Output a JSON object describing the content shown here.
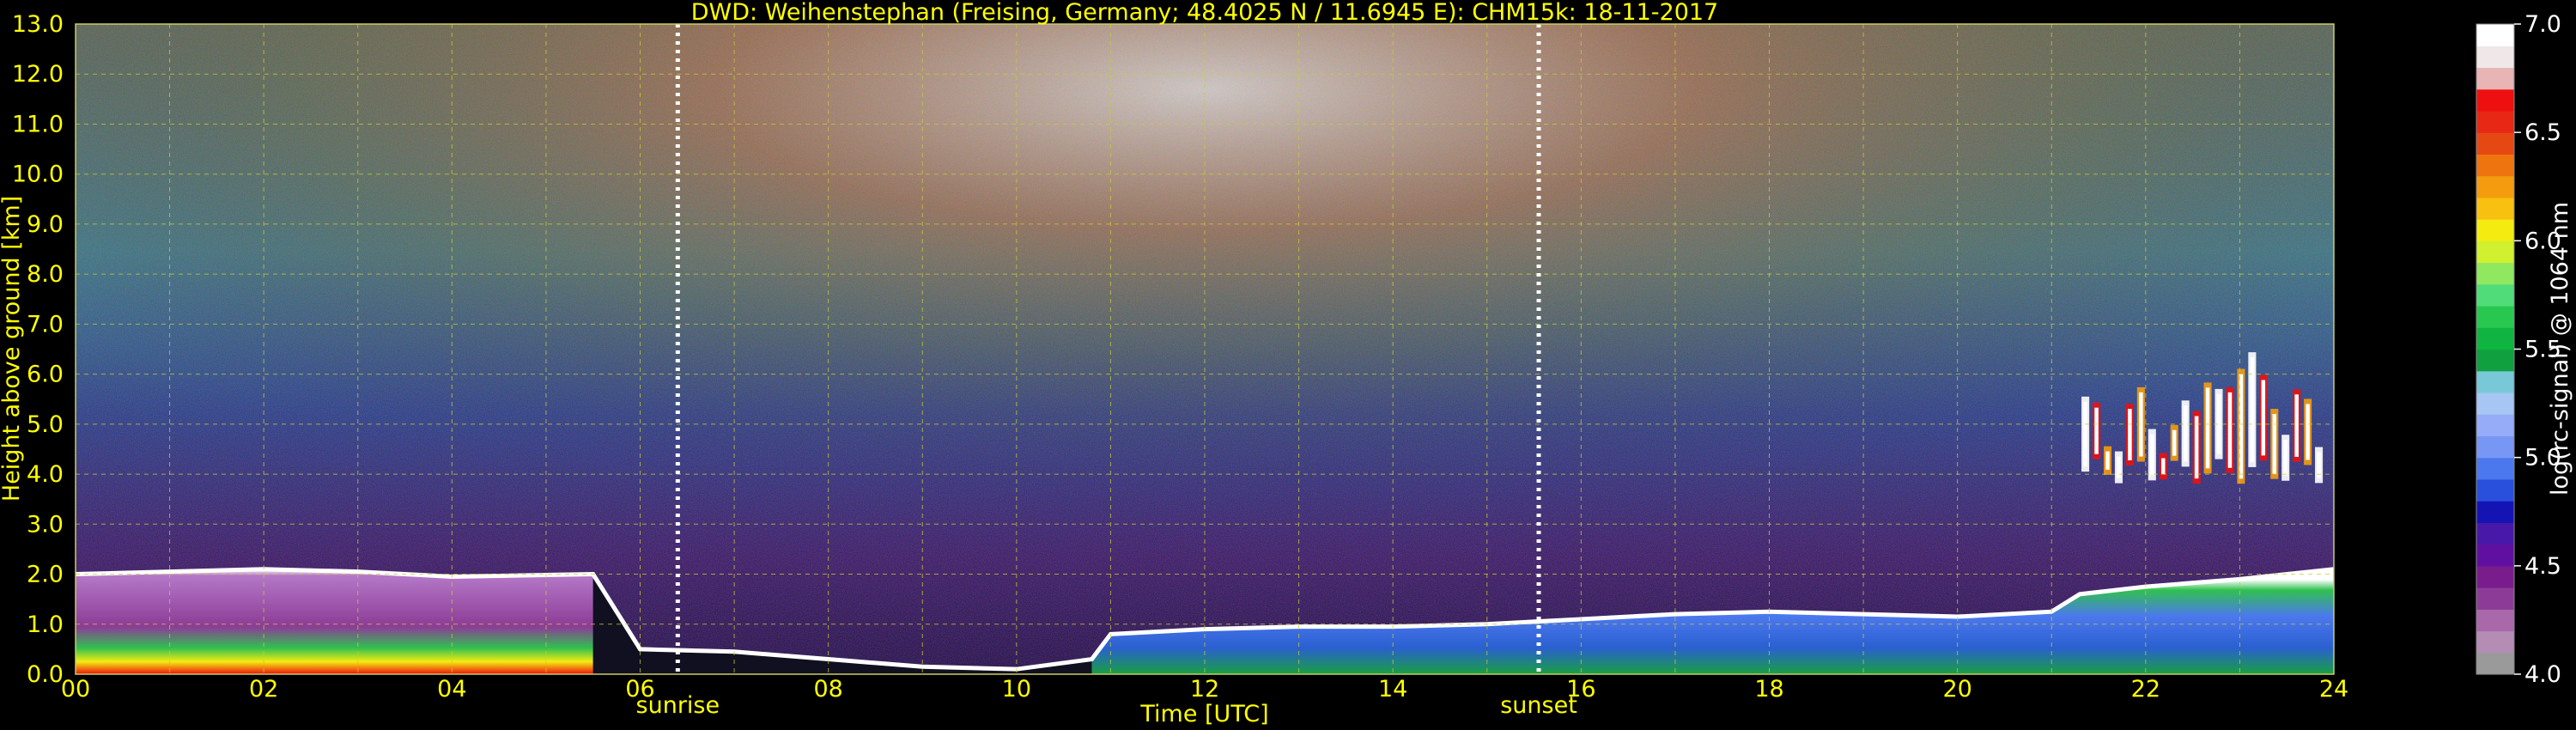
{
  "chart_data": {
    "type": "heatmap",
    "title": "DWD: Weihenstephan (Freising, Germany; 48.4025 N / 11.6945 E):    CHM15k: 18-11-2017",
    "xlabel": "Time [UTC]",
    "ylabel": "Height above ground [km]",
    "xlim": [
      0,
      24
    ],
    "ylim": [
      0,
      13
    ],
    "x_ticks": [
      "00",
      "02",
      "04",
      "06",
      "08",
      "10",
      "12",
      "14",
      "16",
      "18",
      "20",
      "22",
      "24"
    ],
    "y_ticks": [
      "0.0",
      "1.0",
      "2.0",
      "3.0",
      "4.0",
      "5.0",
      "6.0",
      "7.0",
      "8.0",
      "9.0",
      "10.0",
      "11.0",
      "12.0",
      "13.0"
    ],
    "grid": true,
    "annotations": [
      {
        "label": "sunrise",
        "x": 6.4
      },
      {
        "label": "sunset",
        "x": 15.55
      }
    ],
    "colorbar": {
      "label": "log(rc-signal) @ 1064 nm",
      "range": [
        4.0,
        7.0
      ],
      "tick_labels": [
        "4.0",
        "4.5",
        "5.0",
        "5.5",
        "6.0",
        "6.5",
        "7.0"
      ],
      "colors": [
        "#9a9a9a",
        "#b48cb4",
        "#a868aa",
        "#8c3c96",
        "#7a1d8c",
        "#6010a0",
        "#4818a8",
        "#1414b4",
        "#2850dc",
        "#4c78ee",
        "#7896f4",
        "#96acf8",
        "#a8c6f4",
        "#78c8d8",
        "#10a040",
        "#10b440",
        "#28c850",
        "#50dc78",
        "#90e860",
        "#d0f030",
        "#f4ec10",
        "#f8c010",
        "#f49c10",
        "#ee7410",
        "#e64814",
        "#e62814",
        "#ee1010",
        "#e8b4b4",
        "#f0e8e8",
        "#ffffff"
      ]
    },
    "features": {
      "boundary_layer_top_km": [
        [
          0.0,
          2.0
        ],
        [
          1.0,
          2.05
        ],
        [
          2.0,
          2.1
        ],
        [
          3.0,
          2.05
        ],
        [
          4.0,
          1.95
        ],
        [
          5.5,
          2.0
        ],
        [
          6.0,
          0.5
        ],
        [
          7.0,
          0.45
        ],
        [
          8.0,
          0.3
        ],
        [
          9.0,
          0.15
        ],
        [
          10.0,
          0.1
        ],
        [
          10.8,
          0.3
        ],
        [
          11.0,
          0.8
        ],
        [
          12.0,
          0.9
        ],
        [
          13.0,
          0.95
        ],
        [
          14.0,
          0.95
        ],
        [
          15.0,
          1.0
        ],
        [
          16.0,
          1.1
        ],
        [
          17.0,
          1.2
        ],
        [
          18.0,
          1.25
        ],
        [
          19.0,
          1.2
        ],
        [
          20.0,
          1.15
        ],
        [
          21.0,
          1.25
        ],
        [
          21.3,
          1.6
        ],
        [
          22.0,
          1.75
        ],
        [
          23.0,
          1.9
        ],
        [
          24.0,
          2.1
        ]
      ],
      "cloud_layer": {
        "x_range": [
          21.3,
          23.9
        ],
        "z_range_km": [
          3.4,
          6.7
        ]
      }
    }
  }
}
